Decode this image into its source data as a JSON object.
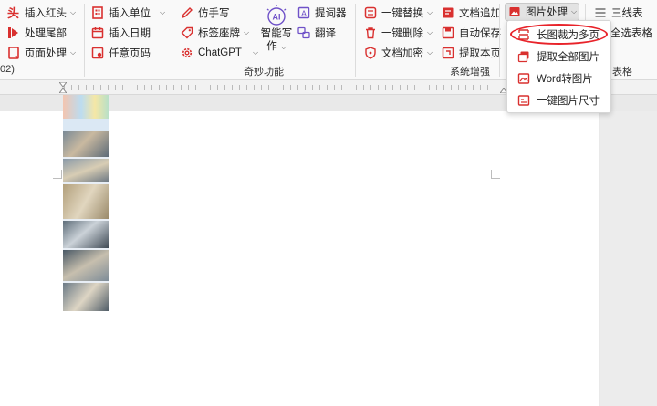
{
  "ribbon": {
    "col1": {
      "insert_header": "插入红头",
      "process_footer": "处理尾部",
      "page_process": "页面处理"
    },
    "col2": {
      "insert_unit": "插入单位",
      "insert_date": "插入日期",
      "any_page_number": "任意页码"
    },
    "col3": {
      "imitate_handwriting": "仿手写",
      "label_seat_card": "标签座牌",
      "chatgpt": "ChatGPT",
      "ai_badge": "AI",
      "smart_writing_line1": "智能写",
      "smart_writing_line2": "作"
    },
    "col4": {
      "prompt_words": "提词器",
      "translate": "翻译"
    },
    "col5": {
      "one_click_replace": "一键替换",
      "one_click_delete": "一键删除",
      "doc_encrypt": "文档加密"
    },
    "col6": {
      "doc_append": "文档追加",
      "auto_save": "自动保存",
      "extract_page": "提取本页"
    },
    "col7": {
      "image_process": "图片处理"
    },
    "col8": {
      "three_line_table": "三线表",
      "select_all_tables": "全选表格"
    },
    "group_labels": {
      "left_partial": "02)",
      "magic": "奇妙功能",
      "system_enhance": "系统增强",
      "table": "表格"
    }
  },
  "dropdown": {
    "items": [
      "长图裁为多页",
      "提取全部图片",
      "Word转图片",
      "一键图片尺寸"
    ]
  },
  "colors": {
    "accent_red": "#d9302f",
    "annotation_red": "#e8232a",
    "ai_purple": "#6f52c8",
    "ribbon_bg": "#f9f9f9"
  }
}
